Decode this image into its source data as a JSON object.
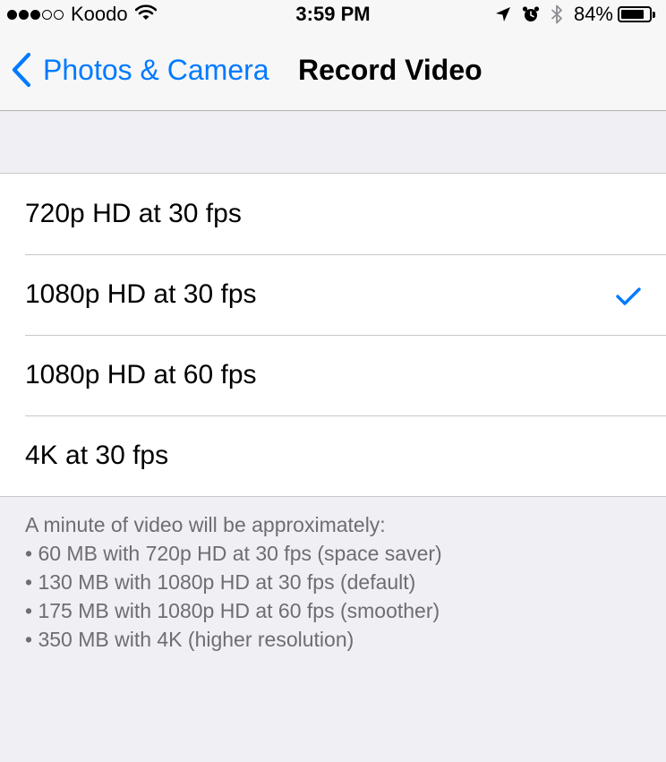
{
  "status_bar": {
    "carrier": "Koodo",
    "time": "3:59 PM",
    "battery_percent": "84%",
    "battery_level": 0.84,
    "signal_bars_filled": 3,
    "signal_bars_total": 5,
    "icons": [
      "wifi-icon",
      "location-arrow-icon",
      "alarm-icon",
      "bluetooth-icon",
      "battery-icon"
    ]
  },
  "nav": {
    "back_label": "Photos & Camera",
    "title": "Record Video"
  },
  "options": [
    {
      "label": "720p HD at 30 fps",
      "selected": false
    },
    {
      "label": "1080p HD at 30 fps",
      "selected": true
    },
    {
      "label": "1080p HD at 60 fps",
      "selected": false
    },
    {
      "label": "4K at 30 fps",
      "selected": false
    }
  ],
  "footer": {
    "intro": "A minute of video will be approximately:",
    "lines": [
      "• 60 MB with 720p HD at 30 fps (space saver)",
      "• 130 MB with 1080p HD at 30 fps (default)",
      "• 175 MB with 1080p HD at 60 fps (smoother)",
      "• 350 MB with 4K (higher resolution)"
    ]
  },
  "colors": {
    "accent": "#007aff",
    "background": "#efeff4",
    "footer_text": "#6d6d72",
    "separator": "#c8c7cc"
  }
}
